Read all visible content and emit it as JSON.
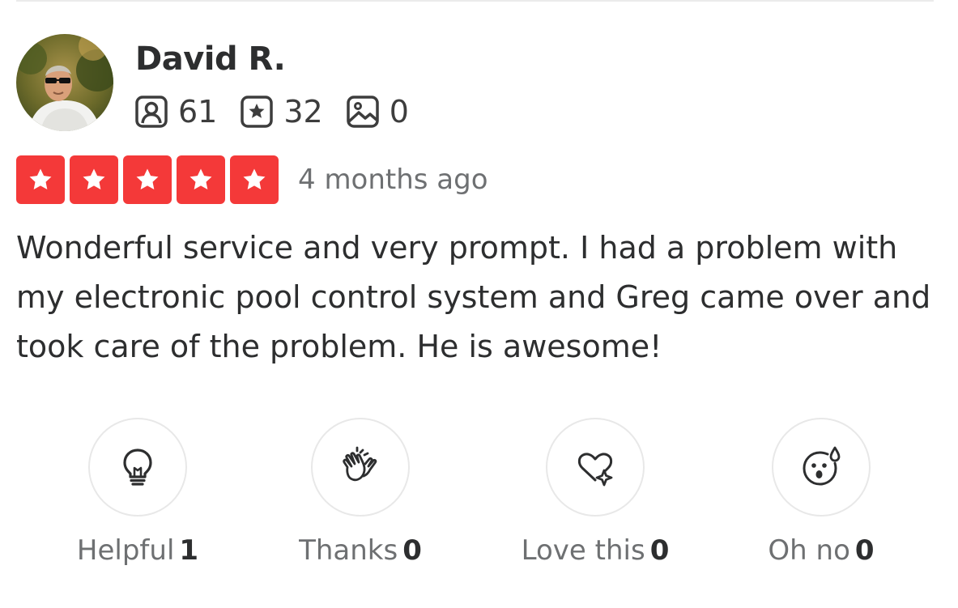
{
  "reviewer": {
    "name": "David R.",
    "stats": {
      "friends": "61",
      "reviews": "32",
      "photos": "0"
    }
  },
  "review": {
    "rating": 5,
    "rating_max": 5,
    "date": "4 months ago",
    "text": "Wonderful service and very prompt. I had a problem with my electronic pool control system and Greg came over and took care of the problem. He is awesome!"
  },
  "reactions": [
    {
      "icon": "lightbulb-icon",
      "label": "Helpful",
      "count": "1"
    },
    {
      "icon": "clapping-hands-icon",
      "label": "Thanks",
      "count": "0"
    },
    {
      "icon": "heart-sparkle-icon",
      "label": "Love this",
      "count": "0"
    },
    {
      "icon": "surprised-face-icon",
      "label": "Oh no",
      "count": "0"
    }
  ],
  "colors": {
    "star_red": "#f43939",
    "text_dark": "#2d2e2f",
    "text_muted": "#6e7072",
    "border": "#e8e8e8"
  }
}
